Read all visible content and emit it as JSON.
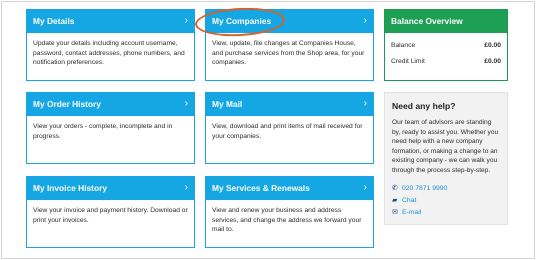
{
  "cards": {
    "details": {
      "title": "My Details",
      "desc": "Update your details including account username, password, contact addresses, phone numbers, and notification preferences."
    },
    "companies": {
      "title": "My Companies",
      "desc": "View, update, file changes at Companies House, and purchase services from the Shop area, for your companies."
    },
    "orders": {
      "title": "My Order History",
      "desc": "View your orders - complete, incomplete and in progress."
    },
    "mail": {
      "title": "My Mail",
      "desc": "View, download and print items of mail received for your companies."
    },
    "invoices": {
      "title": "My Invoice History",
      "desc": "View your invoice and payment history. Download or print your invoices."
    },
    "services": {
      "title": "My Services & Renewals",
      "desc": "View and renew your business and address services, and change the address we forward your mail to."
    }
  },
  "chevron": "›",
  "balance": {
    "title": "Balance Overview",
    "rows": [
      {
        "label": "Balance",
        "value": "£0.00"
      },
      {
        "label": "Credit Limit",
        "value": "£0.00"
      }
    ]
  },
  "help": {
    "title": "Need any help?",
    "text": "Our team of advisors are standing by, ready to assist you. Whether you need help with a new company formation, or making a change to an existing company - we can walk you through the process step-by-step.",
    "phone": "020 7871 9990",
    "chat": "Chat",
    "email": "E-mail"
  },
  "colors": {
    "card_header": "#14a7e3",
    "balance_header": "#1d9f55",
    "highlight_circle": "#d4622e",
    "link": "#1a8fd0"
  },
  "icons": {
    "phone": "phone-icon",
    "chat": "chat-icon",
    "email": "envelope-icon"
  }
}
